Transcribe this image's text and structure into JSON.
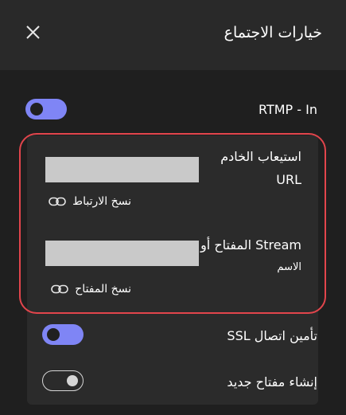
{
  "header": {
    "title": "خيارات الاجتماع"
  },
  "rtmp": {
    "label": "RTMP - In",
    "enabled": true
  },
  "server": {
    "label": "استيعاب الخادم",
    "label_line2": "URL",
    "copy_label": "نسخ الارتباط"
  },
  "stream_key": {
    "label": "Stream المفتاح أو",
    "label_line2": "الاسم",
    "copy_label": "نسخ المفتاح"
  },
  "ssl": {
    "label": "تأمين اتصال SSL",
    "enabled": true
  },
  "new_key": {
    "label": "إنشاء مفتاح جديد",
    "enabled": false
  },
  "colors": {
    "accent": "#7f85f5",
    "highlight": "#e2454c"
  },
  "icons": {
    "close": "close-icon",
    "link": "link-icon"
  }
}
